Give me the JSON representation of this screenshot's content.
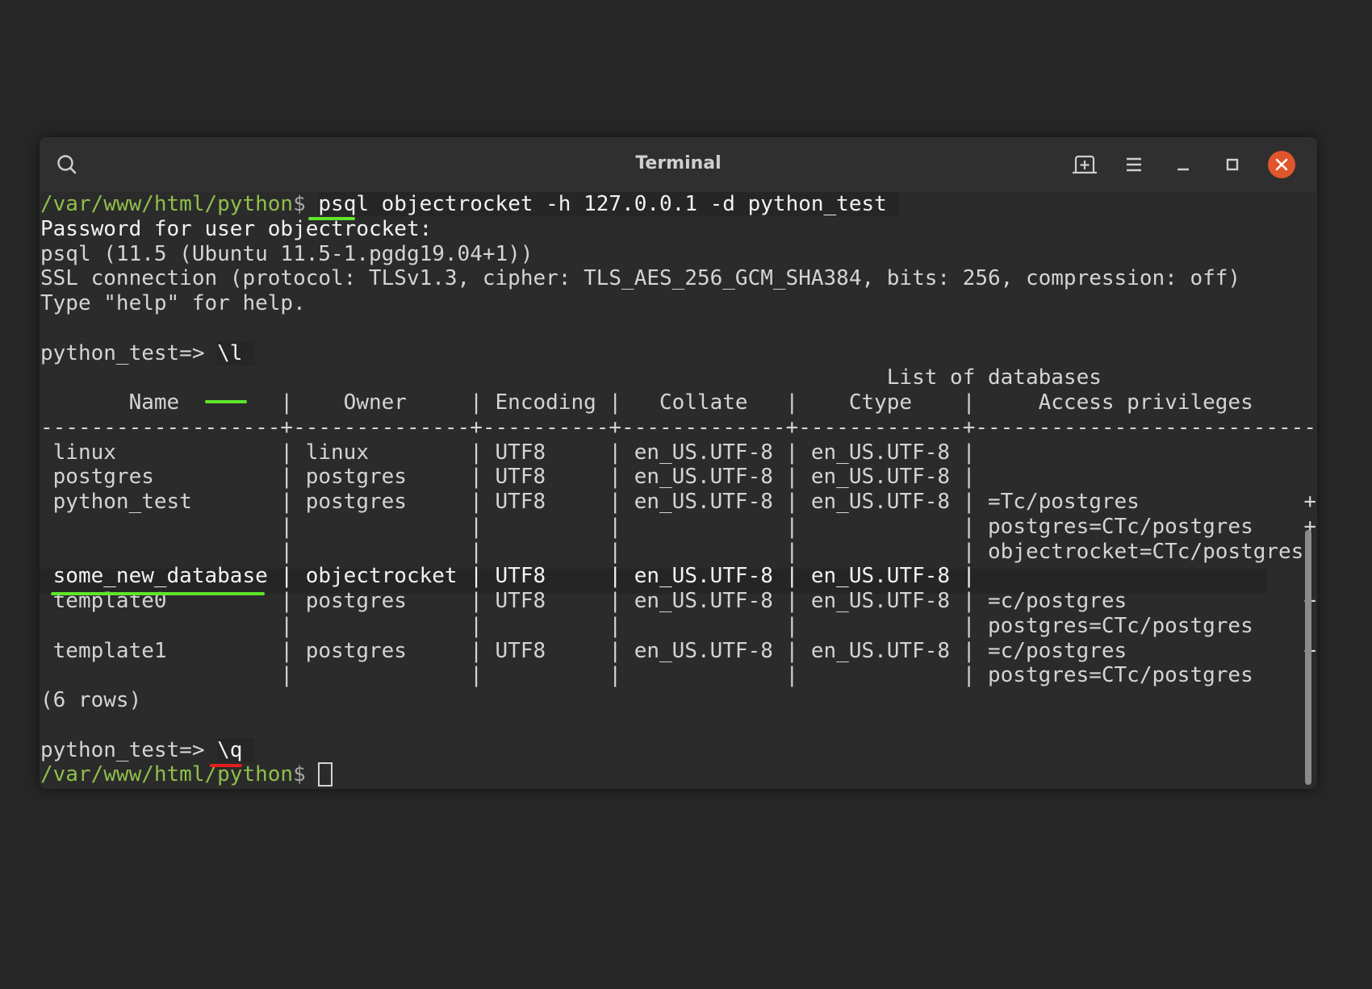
{
  "window": {
    "title": "Terminal"
  },
  "terminal": {
    "lines": [
      {
        "parts": [
          {
            "t": "/var/www/html/python",
            "c": "path"
          },
          {
            "t": "$ ",
            "c": "dollar"
          },
          {
            "t": "psql objectrocket -h 127.0.0.1 -d python_test ",
            "c": "bright hl-cmd"
          }
        ]
      },
      {
        "parts": [
          {
            "t": "Password for user objectrocket:",
            "c": "bright"
          }
        ]
      },
      {
        "parts": [
          {
            "t": "psql (11.5 (Ubuntu 11.5-1.pgdg19.04+1))",
            "c": ""
          }
        ]
      },
      {
        "parts": [
          {
            "t": "SSL connection (protocol: TLSv1.3, cipher: TLS_AES_256_GCM_SHA384, bits: 256, compression: off)",
            "c": ""
          }
        ]
      },
      {
        "parts": [
          {
            "t": "Type \"help\" for help.",
            "c": ""
          }
        ]
      },
      {
        "parts": [
          {
            "t": "",
            "c": ""
          }
        ]
      },
      {
        "parts": [
          {
            "t": "python_test=> ",
            "c": ""
          },
          {
            "t": "\\l ",
            "c": "bright hl-cmd"
          }
        ]
      },
      {
        "parts": [
          {
            "t": "                                                                   List of databases",
            "c": ""
          }
        ]
      },
      {
        "parts": [
          {
            "t": "       Name        |    Owner     | Encoding |   Collate   |    Ctype    |     Access privileges",
            "c": ""
          }
        ]
      },
      {
        "parts": [
          {
            "t": "-------------------+--------------+----------+-------------+-------------+---------------------------",
            "c": ""
          }
        ]
      },
      {
        "parts": [
          {
            "t": " linux             | linux        | UTF8     | en_US.UTF-8 | en_US.UTF-8 |",
            "c": ""
          }
        ]
      },
      {
        "parts": [
          {
            "t": " postgres          | postgres     | UTF8     | en_US.UTF-8 | en_US.UTF-8 |",
            "c": ""
          }
        ]
      },
      {
        "parts": [
          {
            "t": " python_test       | postgres     | UTF8     | en_US.UTF-8 | en_US.UTF-8 | =Tc/postgres             +",
            "c": ""
          }
        ]
      },
      {
        "parts": [
          {
            "t": "                   |              |          |             |             | postgres=CTc/postgres    +",
            "c": ""
          }
        ]
      },
      {
        "parts": [
          {
            "t": "                   |              |          |             |             | objectrocket=CTc/postgres",
            "c": ""
          }
        ]
      },
      {
        "parts": [
          {
            "t": " some_new_database | objectrocket | UTF8     | en_US.UTF-8 | en_US.UTF-8 |",
            "c": "bright"
          }
        ]
      },
      {
        "parts": [
          {
            "t": " template0         | postgres     | UTF8     | en_US.UTF-8 | en_US.UTF-8 | =c/postgres              +",
            "c": ""
          }
        ]
      },
      {
        "parts": [
          {
            "t": "                   |              |          |             |             | postgres=CTc/postgres",
            "c": ""
          }
        ]
      },
      {
        "parts": [
          {
            "t": " template1         | postgres     | UTF8     | en_US.UTF-8 | en_US.UTF-8 | =c/postgres              +",
            "c": ""
          }
        ]
      },
      {
        "parts": [
          {
            "t": "                   |              |          |             |             | postgres=CTc/postgres",
            "c": ""
          }
        ]
      },
      {
        "parts": [
          {
            "t": "(6 rows)",
            "c": ""
          }
        ]
      },
      {
        "parts": [
          {
            "t": "",
            "c": ""
          }
        ]
      },
      {
        "parts": [
          {
            "t": "python_test=> ",
            "c": ""
          },
          {
            "t": "\\q ",
            "c": "bright hl-cmd"
          }
        ]
      },
      {
        "parts": [
          {
            "t": "/var/www/html/python",
            "c": "path"
          },
          {
            "t": "$ ",
            "c": "dollar"
          }
        ],
        "cursor": true
      }
    ]
  },
  "annotations": {
    "highlight_color_green": "#5ee62a",
    "highlight_color_red": "#e0201c"
  },
  "colors": {
    "path": "#8fbf4a",
    "text": "#d4d4d4",
    "background": "#2b2b2b",
    "close_button": "#e0552b"
  }
}
